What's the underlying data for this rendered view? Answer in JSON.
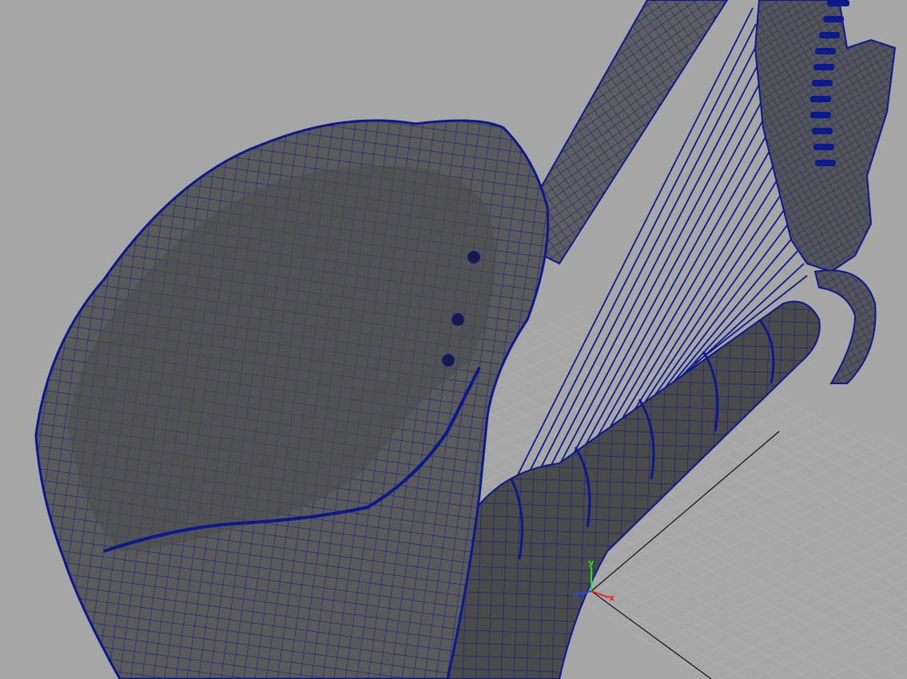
{
  "viewport": {
    "background": "#a6a6a6",
    "wire_color": "#0a1a8c",
    "mesh_fill": "#5a5a5a",
    "mesh_fill_light": "#6c6c6c",
    "mesh_fill_dark": "#3e3e3e",
    "grid_color": "#c2c2c2",
    "grid_axis_color": "#111111"
  },
  "objects": [
    "harp-body",
    "harp-column",
    "harp-neck",
    "harp-strings",
    "soundboard",
    "tuning-pins"
  ],
  "axis_gizmo": {
    "y_label": "y",
    "x_label": "x",
    "y_color": "#22dd22",
    "x_color": "#ee2222",
    "z_color": "#2244ff"
  }
}
